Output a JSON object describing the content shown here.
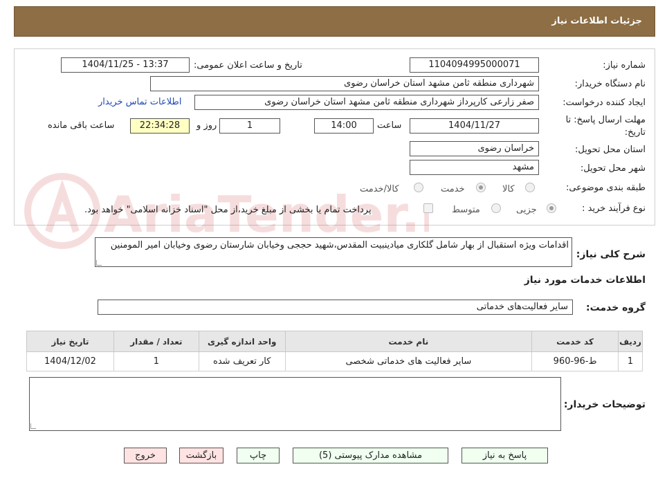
{
  "header": {
    "title": "جزئیات اطلاعات نیاز"
  },
  "fields": {
    "need_number_label": "شماره نیاز:",
    "need_number": "1104094995000071",
    "announce_label": "تاریخ و ساعت اعلان عمومی:",
    "announce_value": "1404/11/25 - 13:37",
    "buyer_org_label": "نام دستگاه خریدار:",
    "buyer_org": "شهرداری منطقه ثامن مشهد استان خراسان رضوی",
    "requester_label": "ایجاد کننده درخواست:",
    "requester": "صفر زارعی کارپرداز شهرداری منطقه ثامن مشهد استان خراسان رضوی",
    "contact_link": "اطلاعات تماس خریدار",
    "deadline_label_1": "مهلت ارسال پاسخ: تا",
    "deadline_label_2": "تاریخ:",
    "deadline_date": "1404/11/27",
    "time_label": "ساعت",
    "deadline_time": "14:00",
    "days_value": "1",
    "days_label": "روز و",
    "remaining_time": "22:34:28",
    "remaining_label": "ساعت باقی مانده",
    "province_label": "استان محل تحویل:",
    "province": "خراسان رضوی",
    "city_label": "شهر محل تحویل:",
    "city": "مشهد",
    "category_label": "طبقه بندی موضوعی:",
    "category_options": [
      "کالا",
      "خدمت",
      "کالا/خدمت"
    ],
    "process_label": "نوع فرآیند خرید :",
    "process_options": [
      "جزیی",
      "متوسط"
    ],
    "payment_note": "پرداخت تمام یا بخشی از مبلغ خرید،از محل \"اسناد خزانه اسلامی\" خواهد بود."
  },
  "watermark": {
    "text": "AriaTender.neT"
  },
  "description": {
    "label": "شرح کلی نیاز:",
    "text": "اقدامات ویژه استقبال از بهار شامل گلکاری میادینبیت المقدس،شهید حججی وخیابان شارستان رضوی وخیابان امیر المومنین"
  },
  "services_section": {
    "title": "اطلاعات خدمات مورد نیاز",
    "group_label": "گروه خدمت:",
    "group_value": "سایر فعالیت‌های خدماتی"
  },
  "table": {
    "headers": [
      "ردیف",
      "کد خدمت",
      "نام خدمت",
      "واحد اندازه گیری",
      "تعداد / مقدار",
      "تاریخ نیاز"
    ],
    "rows": [
      [
        "1",
        "ط-96-960",
        "سایر فعالیت های خدماتی شخصی",
        "کار تعریف شده",
        "1",
        "1404/12/02"
      ]
    ]
  },
  "buyer_notes": {
    "label": "توضیحات خریدار:",
    "text": ""
  },
  "buttons": {
    "reply": "پاسخ به نیاز",
    "attachments": "مشاهده مدارک پیوستی (5)",
    "print": "چاپ",
    "back": "بازگشت",
    "exit": "خروج"
  },
  "colors": {
    "header_bg": "#8d6e45",
    "link": "#1f49b3",
    "remaining_bg": "#ffffc4",
    "button_bg": "#f0fff0",
    "button_red_bg": "#ffe3e3"
  }
}
